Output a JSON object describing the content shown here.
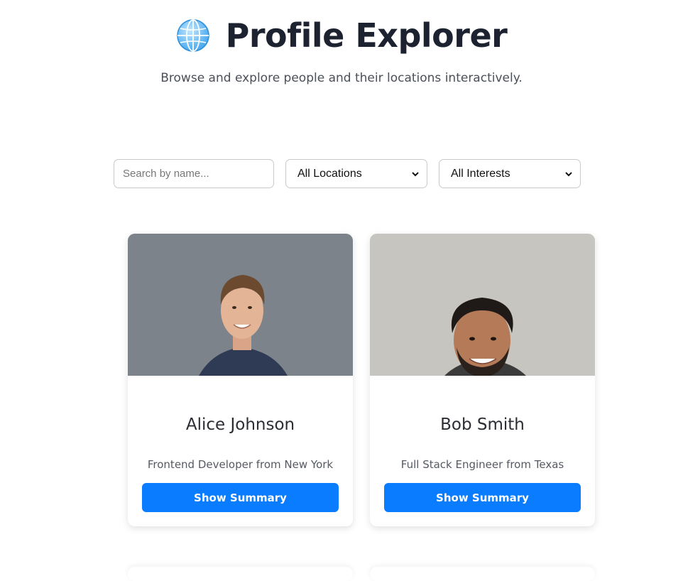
{
  "header": {
    "icon": "globe-icon",
    "title": "Profile Explorer",
    "subtitle": "Browse and explore people and their locations interactively."
  },
  "filters": {
    "search_placeholder": "Search by name...",
    "location_selected": "All Locations",
    "interest_selected": "All Interests"
  },
  "profiles": [
    {
      "name": "Alice Johnson",
      "description": "Frontend Developer from New York",
      "button_label": "Show Summary"
    },
    {
      "name": "Bob Smith",
      "description": "Full Stack Engineer from Texas",
      "button_label": "Show Summary"
    }
  ],
  "colors": {
    "accent": "#0a7cff",
    "title": "#1d2230"
  }
}
